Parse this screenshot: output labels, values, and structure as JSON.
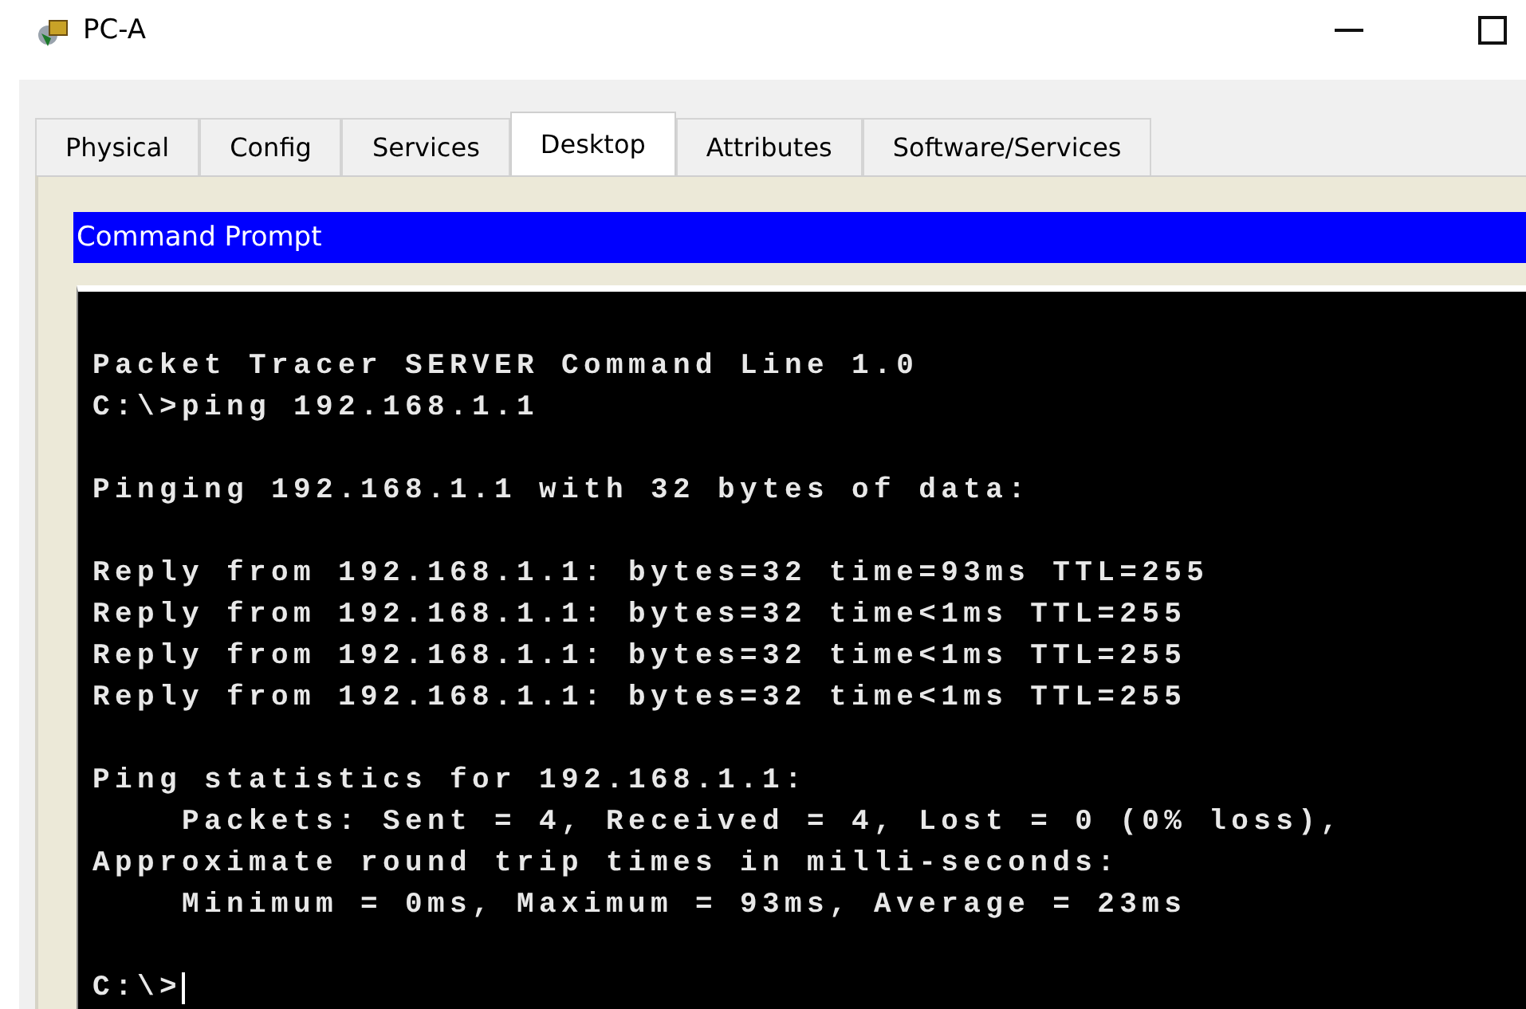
{
  "window": {
    "title": "PC-A"
  },
  "tabs": [
    {
      "label": "Physical",
      "selected": false
    },
    {
      "label": "Config",
      "selected": false
    },
    {
      "label": "Services",
      "selected": false
    },
    {
      "label": "Desktop",
      "selected": true
    },
    {
      "label": "Attributes",
      "selected": false
    },
    {
      "label": "Software/Services",
      "selected": false
    }
  ],
  "app": {
    "title": "Command Prompt"
  },
  "terminal": {
    "blocks": [
      [
        "Packet Tracer SERVER Command Line 1.0",
        "C:\\>ping 192.168.1.1"
      ],
      [
        "Pinging 192.168.1.1 with 32 bytes of data:"
      ],
      [
        "Reply from 192.168.1.1: bytes=32 time=93ms TTL=255",
        "Reply from 192.168.1.1: bytes=32 time<1ms TTL=255",
        "Reply from 192.168.1.1: bytes=32 time<1ms TTL=255",
        "Reply from 192.168.1.1: bytes=32 time<1ms TTL=255"
      ],
      [
        "Ping statistics for 192.168.1.1:",
        "    Packets: Sent = 4, Received = 4, Lost = 0 (0% loss),",
        "Approximate round trip times in milli-seconds:",
        "    Minimum = 0ms, Maximum = 93ms, Average = 23ms"
      ]
    ],
    "prompt": "C:\\>"
  }
}
